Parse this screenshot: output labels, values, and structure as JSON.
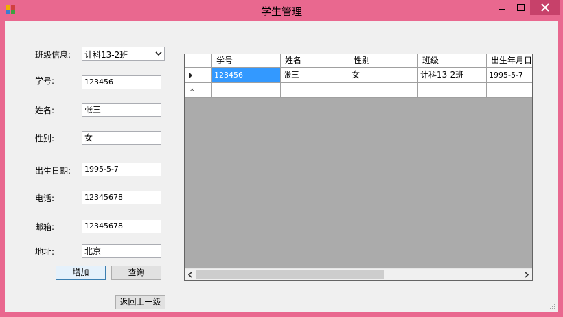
{
  "window": {
    "title": "学生管理"
  },
  "form": {
    "class_label": "班级信息:",
    "class_value": "计科13-2班",
    "id_label": "学号:",
    "id_value": "123456",
    "name_label": "姓名:",
    "name_value": "张三",
    "gender_label": "性别:",
    "gender_value": "女",
    "birth_label": "出生日期:",
    "birth_value": "1995-5-7",
    "phone_label": "电话:",
    "phone_value": "12345678",
    "email_label": "邮箱:",
    "email_value": "12345678",
    "address_label": "地址:",
    "address_value": "北京"
  },
  "buttons": {
    "add": "增加",
    "query": "查询",
    "back": "返回上一级"
  },
  "grid": {
    "columns": [
      "学号",
      "姓名",
      "性别",
      "班级",
      "出生年月日"
    ],
    "rows": [
      [
        "123456",
        "张三",
        "女",
        "计科13-2班",
        "1995-5-7"
      ]
    ],
    "new_row_marker": "*",
    "current_row_marker": "▶"
  },
  "colors": {
    "frame": "#e9688f",
    "selection": "#3399ff",
    "grid_background": "#ababab"
  }
}
